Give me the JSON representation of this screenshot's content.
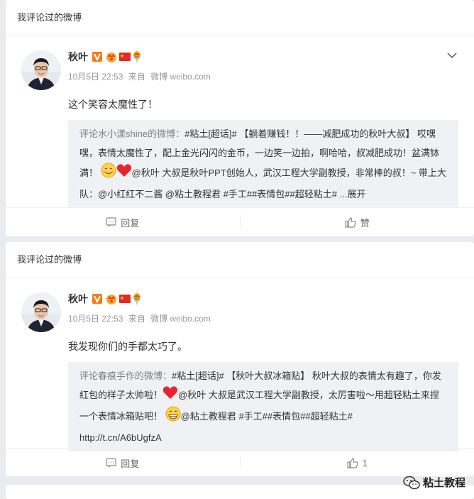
{
  "cards": [
    {
      "header": "我评论过的微博",
      "author": "秋叶",
      "date": "10月5日 22:53",
      "via_label": "来自",
      "source": "微博 weibo.com",
      "comment": "这个笑容太魔性了！",
      "quote": {
        "user": "评论水小漾shine的微博：",
        "seg1": "#粘土[超话]# 【躺着赚钱！！——减肥成功的秋叶大叔】 哎嘿嘿，表情太魔性了，配上金光闪闪的金币，一边笑一边拍，啊哈哈，叔减肥成功！盆满钵满！",
        "seg2": "@秋叶 大叔是秋叶PPT创始人，武汉工程大学副教授，非常棒的叔！~ 带上大队：@小红红不二酱 @粘土教程君 #手工##表情包##超轻粘土# ...展开"
      },
      "reply_label": "回复",
      "like_label": "赞"
    },
    {
      "header": "我评论过的微博",
      "author": "秋叶",
      "date": "10月5日 22:53",
      "via_label": "来自",
      "source": "微博 weibo.com",
      "comment": "我发现你们的手都太巧了。",
      "quote": {
        "user": "评论春痕手作的微博：",
        "seg1": "#粘土[超话]# 【秋叶大叔冰箱贴】 秋叶大叔的表情太有趣了，你发红包的样子太帅啦！",
        "seg2": "@秋叶 大叔是武汉工程大学副教授，太厉害啦～用超轻粘土来捏一个表情冰箱贴吧！",
        "seg3": "@粘土教程君 #手工##表情包##超轻粘土#",
        "link": "http://t.cn/A6bUgfzA"
      },
      "reply_label": "回复",
      "like_label": "1"
    }
  ],
  "watermark": "粘土教程",
  "colors": {
    "background": "#e9ebf0",
    "gray_text": "#999999",
    "quote_bg": "#f0f1f4"
  },
  "icons": [
    "vip-v-icon",
    "crown-icon",
    "china-flag-icon",
    "balloon-icon",
    "chevron-down-icon",
    "comment-icon",
    "thumbs-up-icon",
    "smile-emoji-icon",
    "heart-emoji-icon",
    "grin-emoji-icon",
    "wechat-icon"
  ]
}
